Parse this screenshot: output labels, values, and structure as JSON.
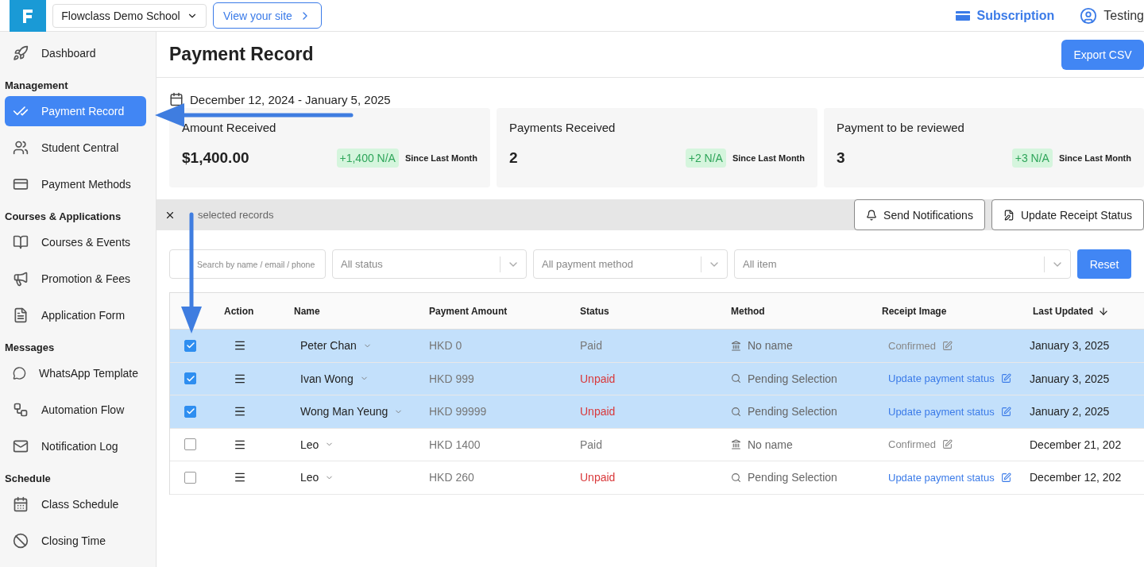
{
  "header": {
    "school": "Flowclass Demo School",
    "view_site": "View your site",
    "subscription": "Subscription",
    "user": "Testing"
  },
  "sidebar": {
    "groups": [
      {
        "items": [
          {
            "label": "Dashboard",
            "selected": false
          }
        ]
      },
      {
        "title": "Management",
        "items": [
          {
            "label": "Payment Record",
            "selected": true
          },
          {
            "label": "Student Central",
            "selected": false
          },
          {
            "label": "Payment Methods",
            "selected": false
          }
        ]
      },
      {
        "title": "Courses & Applications",
        "items": [
          {
            "label": "Courses & Events",
            "selected": false
          },
          {
            "label": "Promotion & Fees",
            "selected": false
          },
          {
            "label": "Application Form",
            "selected": false
          }
        ]
      },
      {
        "title": "Messages",
        "items": [
          {
            "label": "WhatsApp Template",
            "selected": false
          },
          {
            "label": "Automation Flow",
            "selected": false
          },
          {
            "label": "Notification Log",
            "selected": false
          }
        ]
      },
      {
        "title": "Schedule",
        "items": [
          {
            "label": "Class Schedule",
            "selected": false
          },
          {
            "label": "Closing Time",
            "selected": false
          }
        ]
      }
    ]
  },
  "page": {
    "title": "Payment Record",
    "export": "Export CSV",
    "date_range": "December 12, 2024 - January 5, 2025"
  },
  "stats": [
    {
      "label": "Amount Received",
      "value": "$1,400.00",
      "change": "+1,400 N/A",
      "since": "Since Last Month"
    },
    {
      "label": "Payments Received",
      "value": "2",
      "change": "+2 N/A",
      "since": "Since Last Month"
    },
    {
      "label": "Payment to be reviewed",
      "value": "3",
      "change": "+3 N/A",
      "since": "Since Last Month"
    }
  ],
  "selection_bar": {
    "text": "selected records",
    "buttons": [
      "Send Notifications",
      "Update Receipt Status"
    ]
  },
  "filters": {
    "search": {
      "placeholder": "Search by name / email / phone"
    },
    "selects": [
      {
        "placeholder": "All status"
      },
      {
        "placeholder": "All payment method"
      },
      {
        "placeholder": "All item"
      }
    ],
    "reset": "Reset"
  },
  "table": {
    "columns": [
      {
        "label": "Action",
        "sorted": false
      },
      {
        "label": "Name",
        "sorted": false
      },
      {
        "label": "Payment Amount",
        "sorted": false
      },
      {
        "label": "Status",
        "sorted": false
      },
      {
        "label": "Method",
        "sorted": false
      },
      {
        "label": "Receipt Image",
        "sorted": false
      },
      {
        "label": "Last Updated",
        "sorted": true
      }
    ],
    "rows": [
      {
        "selected": true,
        "name": "Peter Chan",
        "amount": "HKD 0",
        "status": {
          "text": "Paid",
          "kind": "paid"
        },
        "method": {
          "text": "No name",
          "kind": "bank"
        },
        "receipt": {
          "text": "Confirmed",
          "kind": "confirmed"
        },
        "updated": "January 3, 2025"
      },
      {
        "selected": true,
        "name": "Ivan Wong",
        "amount": "HKD 999",
        "status": {
          "text": "Unpaid",
          "kind": "unpaid"
        },
        "method": {
          "text": "Pending Selection",
          "kind": "pending"
        },
        "receipt": {
          "text": "Update payment status",
          "kind": "link"
        },
        "updated": "January 3, 2025"
      },
      {
        "selected": true,
        "name": "Wong Man Yeung",
        "amount": "HKD 99999",
        "status": {
          "text": "Unpaid",
          "kind": "unpaid"
        },
        "method": {
          "text": "Pending Selection",
          "kind": "pending"
        },
        "receipt": {
          "text": "Update payment status",
          "kind": "link"
        },
        "updated": "January 2, 2025"
      },
      {
        "selected": false,
        "name": "Leo",
        "amount": "HKD 1400",
        "status": {
          "text": "Paid",
          "kind": "paid"
        },
        "method": {
          "text": "No name",
          "kind": "bank"
        },
        "receipt": {
          "text": "Confirmed",
          "kind": "confirmed"
        },
        "updated": "December 21, 202"
      },
      {
        "selected": false,
        "name": "Leo",
        "amount": "HKD 260",
        "status": {
          "text": "Unpaid",
          "kind": "unpaid"
        },
        "method": {
          "text": "Pending Selection",
          "kind": "pending"
        },
        "receipt": {
          "text": "Update payment status",
          "kind": "link"
        },
        "updated": "December 12, 202"
      }
    ]
  }
}
